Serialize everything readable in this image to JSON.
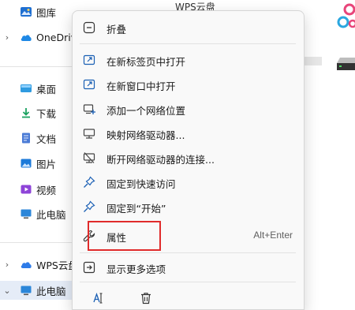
{
  "nav": {
    "items": [
      {
        "label": "图库",
        "icon": "gallery-icon"
      },
      {
        "label": "OneDrive",
        "icon": "onedrive-cloud-icon"
      },
      {
        "label": "桌面",
        "icon": "desktop-icon"
      },
      {
        "label": "下载",
        "icon": "download-icon"
      },
      {
        "label": "文档",
        "icon": "documents-icon"
      },
      {
        "label": "图片",
        "icon": "pictures-icon"
      },
      {
        "label": "视频",
        "icon": "videos-icon"
      },
      {
        "label": "此电脑",
        "icon": "this-pc-icon"
      },
      {
        "label": "WPS云盘",
        "icon": "wps-cloud-icon"
      },
      {
        "label": "此电脑",
        "icon": "this-pc-icon"
      }
    ]
  },
  "background": {
    "cloud_title": "WPS云盘"
  },
  "menu": {
    "items": [
      {
        "label": "折叠",
        "icon": "collapse-icon"
      },
      {
        "label": "在新标签页中打开",
        "icon": "open-new-tab-icon"
      },
      {
        "label": "在新窗口中打开",
        "icon": "open-new-window-icon"
      },
      {
        "label": "添加一个网络位置",
        "icon": "add-network-location-icon"
      },
      {
        "label": "映射网络驱动器...",
        "icon": "map-network-drive-icon"
      },
      {
        "label": "断开网络驱动器的连接...",
        "icon": "disconnect-network-drive-icon"
      },
      {
        "label": "固定到快速访问",
        "icon": "pin-icon"
      },
      {
        "label": "固定到“开始”",
        "icon": "pin-icon"
      },
      {
        "label": "属性",
        "icon": "wrench-icon",
        "shortcut": "Alt+Enter"
      },
      {
        "label": "显示更多选项",
        "icon": "show-more-options-icon"
      }
    ],
    "bottom_icons": [
      "rename-icon",
      "delete-icon"
    ]
  },
  "colors": {
    "accent": "#0067c0",
    "highlight_border": "#e02b2b",
    "menu_bg": "#f9f9f9",
    "selected_bg": "#e5ecf7"
  }
}
